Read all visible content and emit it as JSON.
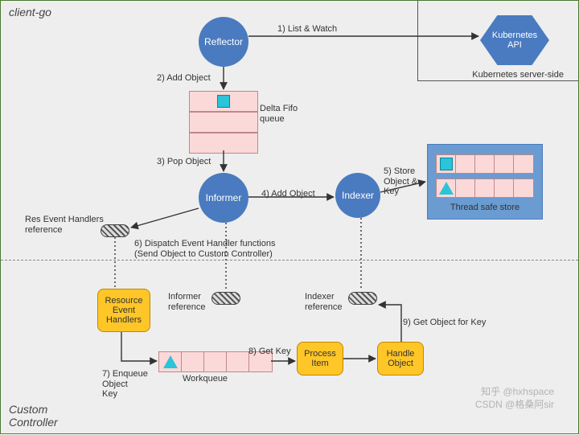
{
  "sections": {
    "top": "client-go",
    "bottom": "Custom\nController"
  },
  "server_side": "Kubernetes server-side",
  "nodes": {
    "reflector": "Reflector",
    "kubeapi": "Kubernetes\nAPI",
    "informer": "Informer",
    "indexer": "Indexer",
    "res_handlers": "Resource\nEvent\nHandlers",
    "process_item": "Process\nItem",
    "handle_object": "Handle\nObject"
  },
  "queues": {
    "delta_fifo": "Delta Fifo\nqueue",
    "workqueue": "Workqueue"
  },
  "store": "Thread safe store",
  "refs": {
    "res_evt": "Res Event Handlers\nreference",
    "informer": "Informer\nreference",
    "indexer": "Indexer\nreference"
  },
  "edges": {
    "e1": "1) List & Watch",
    "e2": "2) Add Object",
    "e3": "3) Pop Object",
    "e4": "4) Add Object",
    "e5": "5) Store\nObject &\nKey",
    "e6": "6) Dispatch Event Handler functions\n(Send Object to Custom Controller)",
    "e7": "7) Enqueue\nObject\nKey",
    "e8": "8) Get Key",
    "e9": "9) Get Object for Key"
  },
  "watermarks": {
    "zhihu": "知乎 @hxhspace",
    "csdn": "CSDN @格桑阿sir"
  }
}
